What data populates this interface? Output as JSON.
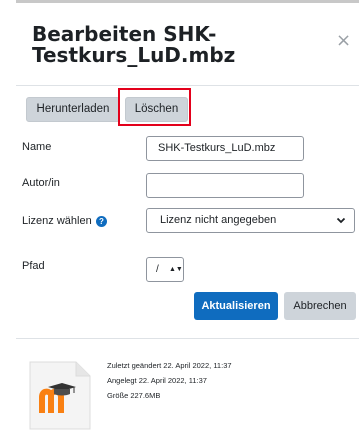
{
  "dialog": {
    "title": "Bearbeiten SHK-Testkurs_LuD.mbz",
    "close_symbol": "×"
  },
  "actions": {
    "download_label": "Herunterladen",
    "delete_label": "Löschen"
  },
  "form": {
    "name_label": "Name",
    "name_value": "SHK-Testkurs_LuD.mbz",
    "author_label": "Autor/in",
    "author_value": "",
    "license_label": "Lizenz wählen",
    "license_value": "Lizenz nicht angegeben",
    "path_label": "Pfad",
    "path_value": "/"
  },
  "buttons": {
    "update_label": "Aktualisieren",
    "cancel_label": "Abbrechen"
  },
  "file_info": {
    "modified": "Zuletzt geändert  22. April 2022, 11:37",
    "created": "Angelegt  22. April 2022, 11:37",
    "size": "Größe  227.6MB",
    "icon": "moodle-backup-file-icon"
  },
  "colors": {
    "primary": "#0f6cbf",
    "highlight": "#e3001b",
    "secondary_button": "#ced4da",
    "moodle_orange": "#f98012"
  }
}
